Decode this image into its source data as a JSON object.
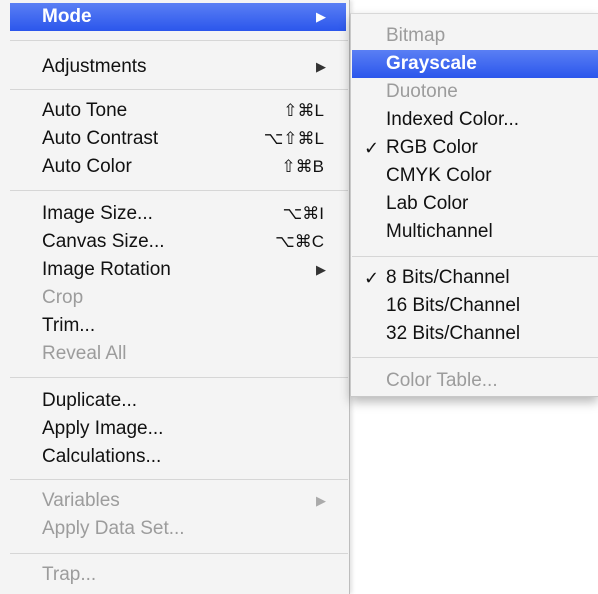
{
  "main_menu": {
    "items": [
      {
        "label": "Mode",
        "arrow": "▶",
        "state": "highlighted"
      },
      {
        "label": "Adjustments",
        "arrow": "▶"
      },
      {
        "label": "Auto Tone",
        "shortcut": "⇧⌘L"
      },
      {
        "label": "Auto Contrast",
        "shortcut": "⌥⇧⌘L"
      },
      {
        "label": "Auto Color",
        "shortcut": "⇧⌘B"
      },
      {
        "label": "Image Size...",
        "shortcut": "⌥⌘I"
      },
      {
        "label": "Canvas Size...",
        "shortcut": "⌥⌘C"
      },
      {
        "label": "Image Rotation",
        "arrow": "▶"
      },
      {
        "label": "Crop",
        "state": "disabled"
      },
      {
        "label": "Trim..."
      },
      {
        "label": "Reveal All",
        "state": "disabled"
      },
      {
        "label": "Duplicate..."
      },
      {
        "label": "Apply Image..."
      },
      {
        "label": "Calculations..."
      },
      {
        "label": "Variables",
        "arrow": "▶",
        "state": "disabled"
      },
      {
        "label": "Apply Data Set...",
        "state": "disabled"
      },
      {
        "label": "Trap...",
        "state": "disabled"
      }
    ]
  },
  "mode_submenu": {
    "items": [
      {
        "label": "Bitmap",
        "state": "disabled"
      },
      {
        "label": "Grayscale",
        "state": "highlighted"
      },
      {
        "label": "Duotone",
        "state": "disabled"
      },
      {
        "label": "Indexed Color..."
      },
      {
        "label": "RGB Color",
        "check": "✓"
      },
      {
        "label": "CMYK Color"
      },
      {
        "label": "Lab Color"
      },
      {
        "label": "Multichannel"
      },
      {
        "label": "8 Bits/Channel",
        "check": "✓"
      },
      {
        "label": "16 Bits/Channel"
      },
      {
        "label": "32 Bits/Channel"
      },
      {
        "label": "Color Table...",
        "state": "disabled"
      }
    ]
  },
  "colors": {
    "highlight": "#2b56ec",
    "disabled_text": "#9c9c9c",
    "menu_background": "#f4f4f4"
  }
}
